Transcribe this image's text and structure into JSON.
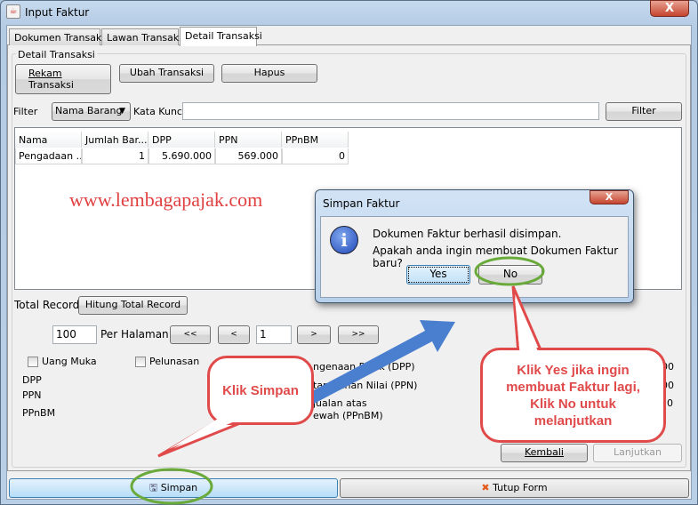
{
  "window": {
    "title": "Input Faktur",
    "close_label": "X"
  },
  "tabs": [
    {
      "label": "Dokumen Transaksi"
    },
    {
      "label": "Lawan Transaksi"
    },
    {
      "label": "Detail Transaksi",
      "selected": true
    }
  ],
  "group": {
    "title": "Detail Transaksi"
  },
  "toolbar": {
    "rekam_1": "Rekam",
    "rekam_2": "Transaksi",
    "ubah": "Ubah Transaksi",
    "hapus": "Hapus"
  },
  "filter": {
    "label": "Filter",
    "combo_value": "Nama Barang",
    "kata_kunci_label": "Kata Kunci",
    "kata_kunci_value": "",
    "button": "Filter"
  },
  "table": {
    "columns": [
      "Nama",
      "Jumlah Bar...",
      "DPP",
      "PPN",
      "PPnBM"
    ],
    "rows": [
      [
        "Pengadaan ...",
        "1",
        "5.690.000",
        "569.000",
        "0"
      ]
    ]
  },
  "watermark": "www.lembagapajak.com",
  "paging": {
    "total_record_label": "Total Record",
    "hitung_button": "Hitung Total Record",
    "per_page_value": "100",
    "per_page_label": "Per Halaman",
    "first": "<<",
    "prev": "<",
    "page_value": "1",
    "next": ">",
    "last": ">>"
  },
  "summary": {
    "uang_muka": "Uang Muka",
    "pelunasan": "Pelunasan",
    "dpp": "DPP",
    "ppn": "PPN",
    "ppnbm": "PPnBM",
    "right_labels": [
      "ngenaan Pajak (DPP)",
      "tambahan Nilai (PPN)",
      "jualan atas",
      "ewah (PPnBM)"
    ],
    "right_values": [
      "00",
      "00",
      "0"
    ]
  },
  "nav": {
    "kembali": "Kembali",
    "lanjutkan": "Lanjutkan"
  },
  "footer": {
    "simpan": "Simpan",
    "tutup": "Tutup Form"
  },
  "dialog": {
    "title": "Simpan Faktur",
    "close_label": "X",
    "line1": "Dokumen Faktur berhasil disimpan.",
    "line2": "Apakah anda ingin membuat Dokumen Faktur baru?",
    "yes": "Yes",
    "no": "No",
    "icon": "info-icon"
  },
  "annotations": {
    "callout1": "Klik Simpan",
    "callout2": "Klik Yes jika ingin membuat Faktur lagi, Klik No untuk melanjutkan",
    "callout_color": "#e04a4a",
    "arrow_color": "#4a7fcf",
    "highlight_color": "#6aaa3a"
  }
}
